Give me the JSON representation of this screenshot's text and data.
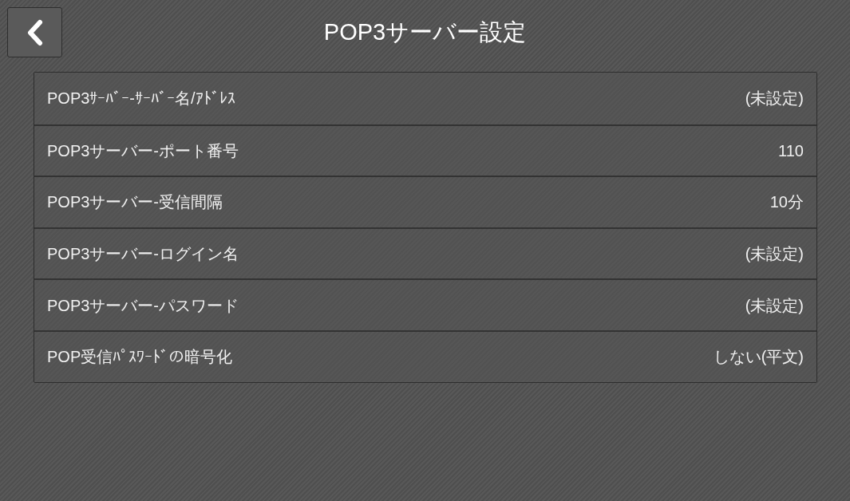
{
  "header": {
    "title": "POP3サーバー設定"
  },
  "settings": [
    {
      "label": "POP3ｻｰﾊﾞｰ-ｻｰﾊﾞｰ名/ｱﾄﾞﾚｽ",
      "value": "(未設定)"
    },
    {
      "label": "POP3サーバー-ポート番号",
      "value": "110"
    },
    {
      "label": "POP3サーバー-受信間隔",
      "value": "10分"
    },
    {
      "label": "POP3サーバー-ログイン名",
      "value": "(未設定)"
    },
    {
      "label": "POP3サーバー-パスワード",
      "value": "(未設定)"
    },
    {
      "label": "POP受信ﾊﾟｽﾜｰﾄﾞの暗号化",
      "value": "しない(平文)"
    }
  ]
}
